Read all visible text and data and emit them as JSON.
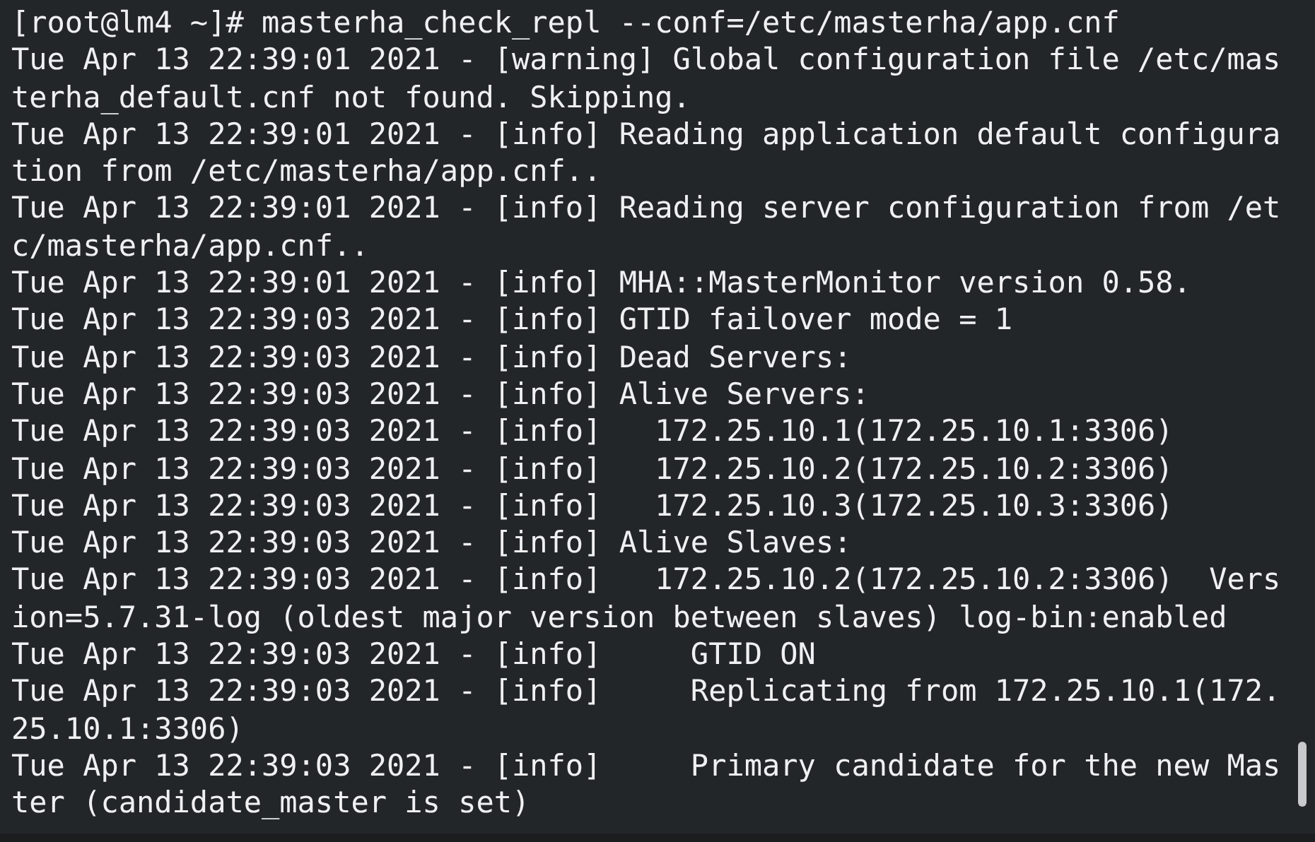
{
  "terminal": {
    "lines": [
      "[root@lm4 ~]# masterha_check_repl --conf=/etc/masterha/app.cnf",
      "Tue Apr 13 22:39:01 2021 - [warning] Global configuration file /etc/mas",
      "terha_default.cnf not found. Skipping.",
      "Tue Apr 13 22:39:01 2021 - [info] Reading application default configura",
      "tion from /etc/masterha/app.cnf..",
      "Tue Apr 13 22:39:01 2021 - [info] Reading server configuration from /et",
      "c/masterha/app.cnf..",
      "Tue Apr 13 22:39:01 2021 - [info] MHA::MasterMonitor version 0.58.",
      "Tue Apr 13 22:39:03 2021 - [info] GTID failover mode = 1",
      "Tue Apr 13 22:39:03 2021 - [info] Dead Servers:",
      "Tue Apr 13 22:39:03 2021 - [info] Alive Servers:",
      "Tue Apr 13 22:39:03 2021 - [info]   172.25.10.1(172.25.10.1:3306)",
      "Tue Apr 13 22:39:03 2021 - [info]   172.25.10.2(172.25.10.2:3306)",
      "Tue Apr 13 22:39:03 2021 - [info]   172.25.10.3(172.25.10.3:3306)",
      "Tue Apr 13 22:39:03 2021 - [info] Alive Slaves:",
      "Tue Apr 13 22:39:03 2021 - [info]   172.25.10.2(172.25.10.2:3306)  Vers",
      "ion=5.7.31-log (oldest major version between slaves) log-bin:enabled",
      "Tue Apr 13 22:39:03 2021 - [info]     GTID ON",
      "Tue Apr 13 22:39:03 2021 - [info]     Replicating from 172.25.10.1(172.",
      "25.10.1:3306)",
      "Tue Apr 13 22:39:03 2021 - [info]     Primary candidate for the new Mas",
      "ter (candidate_master is set)"
    ]
  }
}
